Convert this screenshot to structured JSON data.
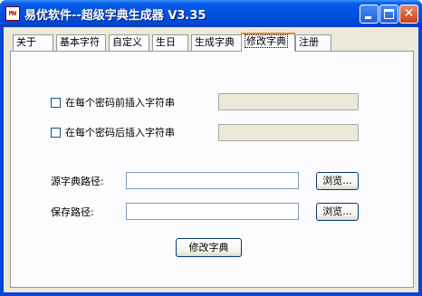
{
  "window": {
    "title": "易优软件--超级字典生成器 V3.35",
    "icon_text": "MW",
    "minimize_icon": "minimize-icon",
    "maximize_icon": "maximize-icon",
    "close_glyph": "✕"
  },
  "tabs": [
    {
      "label": "关于"
    },
    {
      "label": "基本字符"
    },
    {
      "label": "自定义"
    },
    {
      "label": "生日"
    },
    {
      "label": "生成字典"
    },
    {
      "label": "修改字典",
      "active": true
    },
    {
      "label": "注册"
    }
  ],
  "form": {
    "prefix_label": "在每个密码前插入字符串",
    "prefix_checked": false,
    "prefix_value": "",
    "suffix_label": "在每个密码后插入字符串",
    "suffix_checked": false,
    "suffix_value": "",
    "source_label": "源字典路径:",
    "source_value": "",
    "browse1_label": "浏览...",
    "save_label": "保存路径:",
    "save_value": "",
    "browse2_label": "浏览...",
    "submit_label": "修改字典"
  }
}
